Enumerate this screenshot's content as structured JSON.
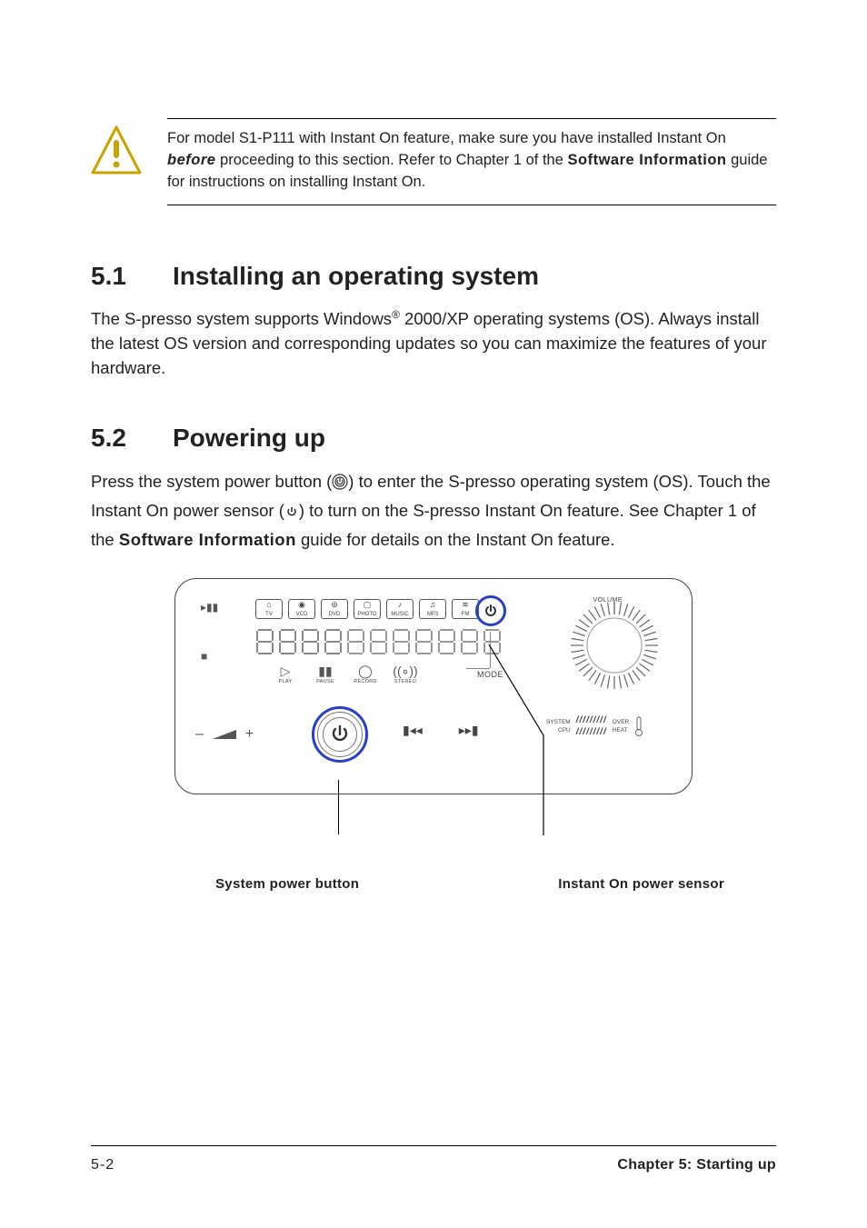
{
  "warning": {
    "pre": "For model S1-P111 with Instant On feature, make sure you have installed Instant On ",
    "bold1": "before",
    "mid": " proceeding to this section. Refer to Chapter 1 of the ",
    "bold2": "Software Information",
    "post": " guide for instructions on installing Instant On."
  },
  "s1": {
    "num": "5.1",
    "title": "Installing an operating system",
    "body_a": "The S-presso system supports Windows",
    "body_sup": "®",
    "body_b": " 2000/XP operating systems (OS). Always install the latest OS version and corresponding updates so you can maximize the features of your hardware."
  },
  "s2": {
    "num": "5.2",
    "title": "Powering up",
    "p_a": "Press the system power button (",
    "p_b": ") to enter the S-presso operating system (OS). Touch the Instant On power sensor (",
    "p_c": ") to turn on the S-presso Instant On feature. See Chapter 1 of the ",
    "p_bold": "Software Information",
    "p_d": " guide for details on the Instant On feature."
  },
  "panel": {
    "top_labels": [
      "TV",
      "VCD",
      "DVD",
      "PHOTO",
      "MUSIC",
      "MP3",
      "FM"
    ],
    "play_labels": [
      "PLAY",
      "PAUSE",
      "RECORD",
      "STEREO"
    ],
    "mode": "MODE",
    "volume": "VOLUME",
    "sys": "SYSTEM",
    "cpu": "CPU",
    "over": "OVER",
    "heat": "HEAT"
  },
  "captions": {
    "left": "System power button",
    "right": "Instant On power sensor"
  },
  "footer": {
    "page": "5-2",
    "chapter": "Chapter 5: Starting up"
  }
}
